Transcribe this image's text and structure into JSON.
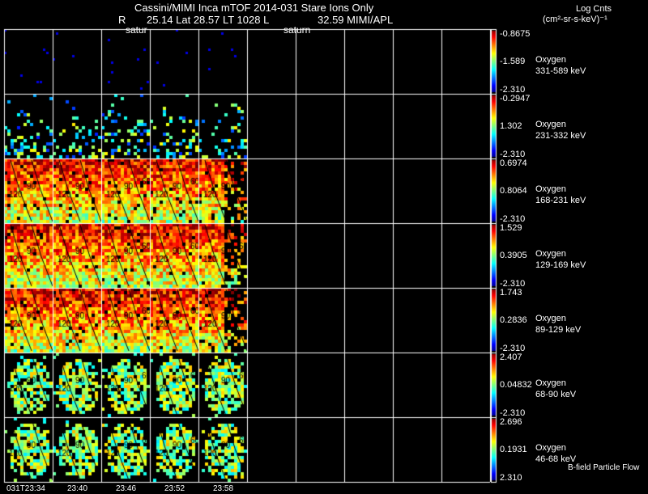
{
  "header": {
    "title": "Cassini/MIMI Inca mTOF  2014-031    Stare    Ions Only",
    "subtitle_r": "R",
    "subtitle_rest": "25.14 Lat 28.57 LT 1028 L",
    "subtitle_l": "32.59  MIMI/APL",
    "object_labels": [
      "satur",
      "saturn"
    ]
  },
  "units": {
    "line1": "Log Cnts",
    "line2": "(cm²-sr-s-keV)⁻¹"
  },
  "footer": {
    "flow_label": "B-field Particle Flow"
  },
  "colors": {
    "grid": "#ffffff",
    "background": "#000000"
  },
  "chart_data": {
    "type": "heatmap",
    "time_labels": [
      "031T23:34",
      "23:40",
      "23:46",
      "23:52",
      "23:58"
    ],
    "columns": 10,
    "contour_labels": [
      "120",
      "90",
      "60"
    ],
    "rows": [
      {
        "species": "Oxygen",
        "energy": "331-589 keV",
        "max": "-0.8675",
        "mid": "-1.589",
        "min": "-2.310",
        "density": 0.02
      },
      {
        "species": "Oxygen",
        "energy": "231-332 keV",
        "max": "-0.2947",
        "mid": "1.302",
        "min": "-2.310",
        "density": 0.35
      },
      {
        "species": "Oxygen",
        "energy": "168-231 keV",
        "max": "0.6974",
        "mid": "0.8064",
        "min": "-2.310",
        "density": 0.95
      },
      {
        "species": "Oxygen",
        "energy": "129-169 keV",
        "max": "1.529",
        "mid": "0.3905",
        "min": "-2.310",
        "density": 0.97
      },
      {
        "species": "Oxygen",
        "energy": "89-129 keV",
        "max": "1.743",
        "mid": "0.2836",
        "min": "-2.310",
        "density": 0.95
      },
      {
        "species": "Oxygen",
        "energy": "68-90 keV",
        "max": "2.407",
        "mid": "0.04832",
        "min": "-2.310",
        "density": 0.8
      },
      {
        "species": "Oxygen",
        "energy": "46-68 keV",
        "max": "2.696",
        "mid": "0.1931",
        "min": "2.310",
        "density": 0.75
      }
    ]
  }
}
